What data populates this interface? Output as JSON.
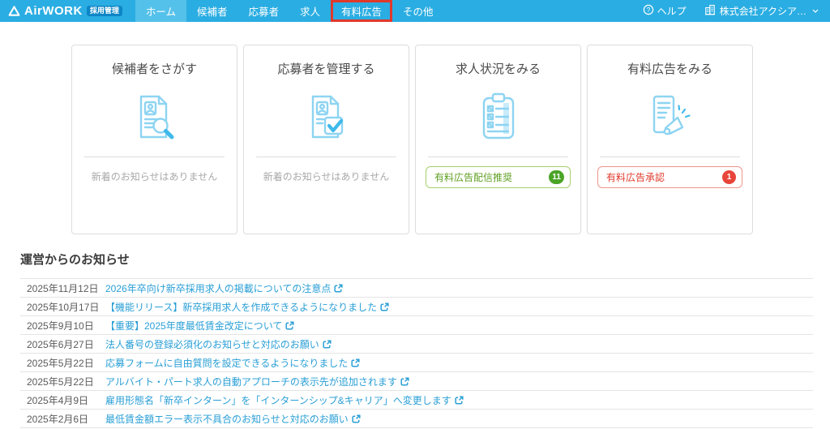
{
  "header": {
    "logo": {
      "brand": "AirWORK",
      "badge": "採用管理"
    },
    "nav": [
      {
        "label": "ホーム",
        "active": true
      },
      {
        "label": "候補者"
      },
      {
        "label": "応募者"
      },
      {
        "label": "求人"
      },
      {
        "label": "有料広告",
        "highlighted": true
      },
      {
        "label": "その他"
      }
    ],
    "help_label": "ヘルプ",
    "account_name": "株式会社アクシア…"
  },
  "cards": [
    {
      "title": "候補者をさがす",
      "icon": "candidate-search-icon",
      "status": "新着のお知らせはありません"
    },
    {
      "title": "応募者を管理する",
      "icon": "applicant-manage-icon",
      "status": "新着のお知らせはありません"
    },
    {
      "title": "求人状況をみる",
      "icon": "job-status-icon",
      "action": {
        "label": "有料広告配信推奨",
        "count": "11",
        "color": "green"
      }
    },
    {
      "title": "有料広告をみる",
      "icon": "paid-ad-icon",
      "action": {
        "label": "有料広告承認",
        "count": "1",
        "color": "red"
      }
    }
  ],
  "notices": {
    "heading": "運営からのお知らせ",
    "items": [
      {
        "date": "2025年11月12日",
        "title": "2026年卒向け新卒採用求人の掲載についての注意点"
      },
      {
        "date": "2025年10月17日",
        "title": "【機能リリース】新卒採用求人を作成できるようになりました"
      },
      {
        "date": "2025年9月10日",
        "title": "【重要】2025年度最低賃金改定について"
      },
      {
        "date": "2025年6月27日",
        "title": "法人番号の登録必須化のお知らせと対応のお願い"
      },
      {
        "date": "2025年5月22日",
        "title": "応募フォームに自由質問を設定できるようになりました"
      },
      {
        "date": "2025年5月22日",
        "title": "アルバイト・パート求人の自動アプローチの表示先が追加されます"
      },
      {
        "date": "2025年4月9日",
        "title": "雇用形態名「新卒インターン」を「インターンシップ&キャリア」へ変更します"
      },
      {
        "date": "2025年2月6日",
        "title": "最低賃金額エラー表示不具合のお知らせと対応のお願い"
      }
    ]
  },
  "colors": {
    "header_blue": "#2aade2",
    "active_tab_blue": "#54c1ea",
    "logo_badge_blue": "#0d86c6",
    "link_blue": "#2a9fd6",
    "icon_light_blue": "#8dd4f2",
    "icon_accent_blue": "#3fb9ea",
    "green_text": "#61a024",
    "green_badge": "#4ba426",
    "red_text": "#e13a2c",
    "red_badge": "#e8453a",
    "annotation_red": "#e0392c"
  }
}
